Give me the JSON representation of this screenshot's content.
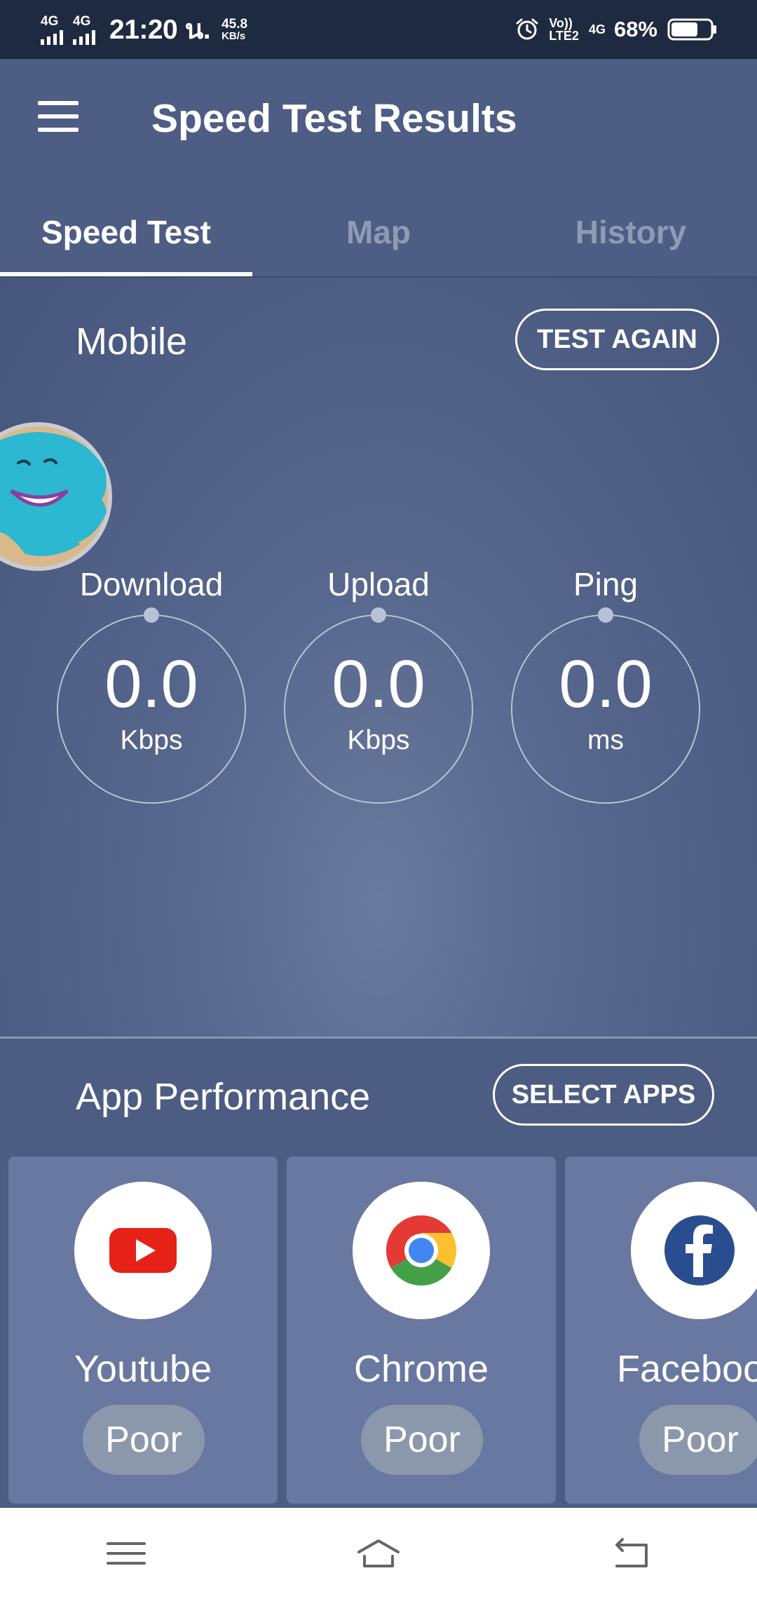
{
  "status_bar": {
    "network_1": "4G",
    "network_2": "4G",
    "time": "21:20 น.",
    "speed_value": "45.8",
    "speed_unit": "KB/s",
    "volte_top": "Vo))",
    "volte_bottom": "LTE2",
    "lte_label": "4G",
    "battery_percent": "68%",
    "battery_level": 0.68,
    "icons": [
      "alarm-icon",
      "battery-icon",
      "signal-icon"
    ]
  },
  "app_bar": {
    "title": "Speed Test Results",
    "tabs": [
      {
        "label": "Speed Test",
        "active": true
      },
      {
        "label": "Map",
        "active": false
      },
      {
        "label": "History",
        "active": false
      }
    ]
  },
  "results": {
    "connection_type": "Mobile",
    "test_again_label": "TEST AGAIN",
    "metrics": [
      {
        "label": "Download",
        "value": "0.0",
        "unit": "Kbps"
      },
      {
        "label": "Upload",
        "value": "0.0",
        "unit": "Kbps"
      },
      {
        "label": "Ping",
        "value": "0.0",
        "unit": "ms"
      }
    ]
  },
  "app_performance": {
    "title": "App Performance",
    "select_apps_label": "SELECT APPS",
    "apps": [
      {
        "name": "Youtube",
        "rating": "Poor",
        "icon": "youtube-icon"
      },
      {
        "name": "Chrome",
        "rating": "Poor",
        "icon": "chrome-icon"
      },
      {
        "name": "Faceboo",
        "rating": "Poor",
        "icon": "facebook-icon"
      }
    ]
  },
  "colors": {
    "status_bar": "#1e2a40",
    "app_bar": "#4d5d84",
    "card": "#6878a0",
    "badge": "#8b98ac",
    "youtube_red": "#e62117",
    "facebook_blue": "#2a4d8f"
  }
}
